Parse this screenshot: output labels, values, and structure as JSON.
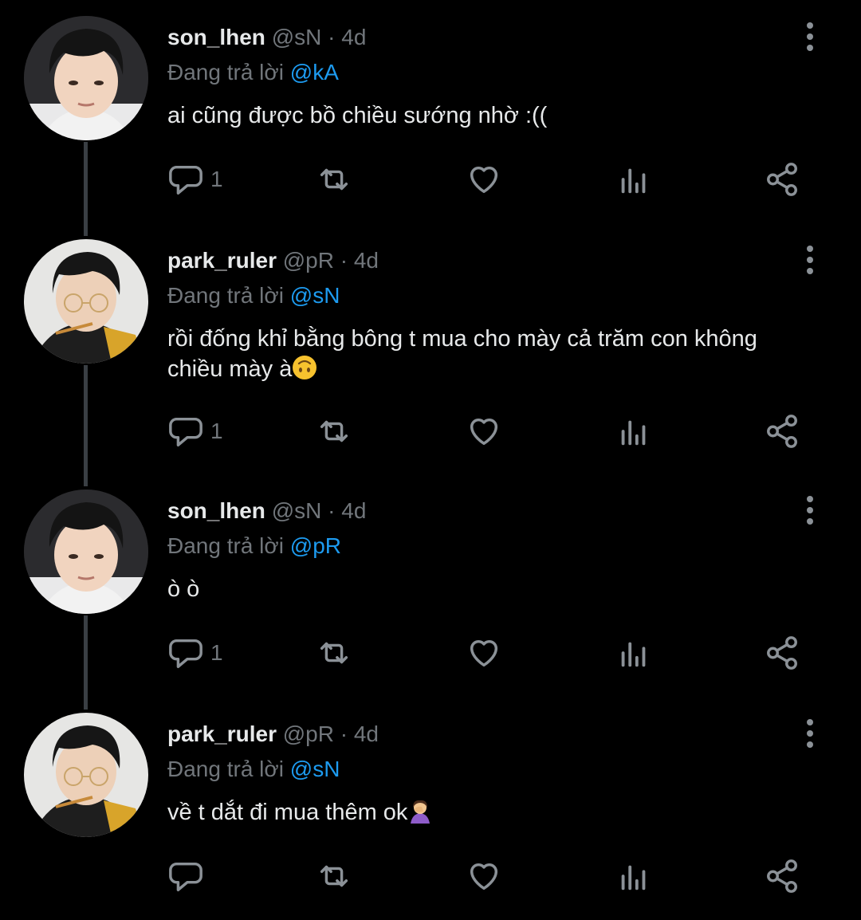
{
  "tweets": [
    {
      "name": "son_lhen",
      "handle": "@sN",
      "time": "4d",
      "reply_prefix": "Đang trả lời",
      "reply_to": "@kA",
      "text": "ai cũng được bồ chiều sướng nhờ :((",
      "emoji": "",
      "reply_count": "1"
    },
    {
      "name": "park_ruler",
      "handle": "@pR",
      "time": "4d",
      "reply_prefix": "Đang trả lời",
      "reply_to": "@sN",
      "text": "rồi đống khỉ bằng bông t mua cho mày cả trăm con không chiều mày à",
      "emoji": "upside-down-face",
      "reply_count": "1"
    },
    {
      "name": "son_lhen",
      "handle": "@sN",
      "time": "4d",
      "reply_prefix": "Đang trả lời",
      "reply_to": "@pR",
      "text": "ò ò",
      "emoji": "",
      "reply_count": "1"
    },
    {
      "name": "park_ruler",
      "handle": "@pR",
      "time": "4d",
      "reply_prefix": "Đang trả lời",
      "reply_to": "@sN",
      "text": "về t dắt đi mua thêm ok",
      "emoji": "woman-facepalming",
      "reply_count": ""
    }
  ],
  "separator": "·",
  "icons": [
    "reply-icon",
    "retweet-icon",
    "like-icon",
    "views-icon",
    "share-icon",
    "more-options-icon"
  ],
  "colors": {
    "background": "#000000",
    "text": "#e7e9ea",
    "muted": "#71767b",
    "mention": "#1d9bf0",
    "thread_line": "#3a3f44"
  }
}
